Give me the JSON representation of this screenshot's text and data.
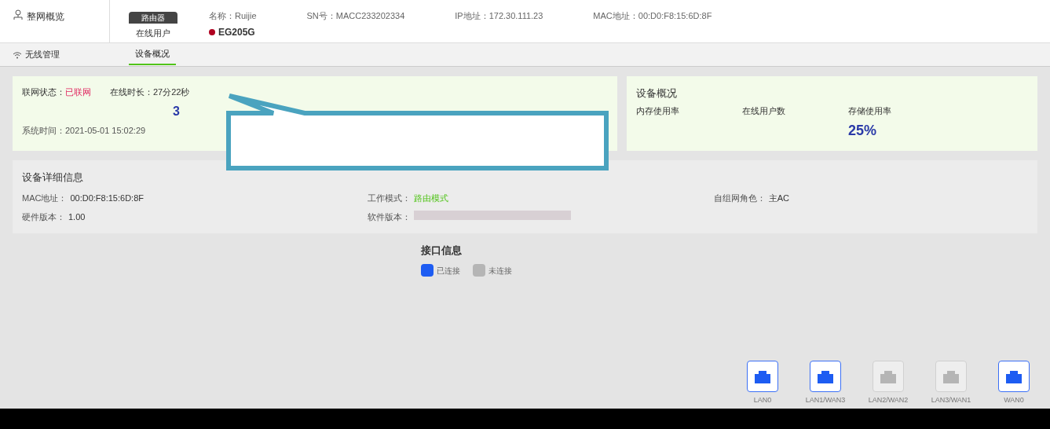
{
  "sidebar": {
    "title": "整网概览",
    "menu_item": "无线管理"
  },
  "device": {
    "badge": "路由器",
    "online_label": "在线用户",
    "model": "EG205G",
    "fields": [
      {
        "text": "名称：Ruijie"
      },
      {
        "text": "SN号：MACC233202334"
      },
      {
        "text": "IP地址：172.30.111.23"
      },
      {
        "text": "MAC地址：00:D0:F8:15:6D:8F"
      }
    ]
  },
  "tabs": [
    {
      "label": "设备概况",
      "selected": true
    }
  ],
  "status": {
    "network": {
      "label": "联网状态：",
      "value": "已联网"
    },
    "uptime": "在线时长：27分22秒",
    "count": "3",
    "system_time": "系统时间：2021-05-01 15:02:29"
  },
  "overview": {
    "title": "设备概况",
    "metrics": [
      {
        "label": "内存使用率"
      },
      {
        "label": "在线用户数"
      },
      {
        "label": "存储使用率",
        "value": "25%"
      }
    ]
  },
  "details": {
    "title": "设备详细信息",
    "fields": [
      {
        "label": "MAC地址：",
        "value": "00:D0:F8:15:6D:8F"
      },
      {
        "label": "工作模式：",
        "value": "路由模式"
      },
      {
        "label": "自组网角色：",
        "value": "主AC"
      },
      {
        "label": "硬件版本：",
        "value": "1.00"
      },
      {
        "label": "软件版本："
      }
    ]
  },
  "interfaces": {
    "title": "接口信息",
    "legend": [
      {
        "label": "已连接",
        "connected": true
      },
      {
        "label": "未连接",
        "connected": false
      }
    ],
    "ports": [
      {
        "name": "LAN0",
        "connected": true
      },
      {
        "name": "LAN1/WAN3",
        "connected": true
      },
      {
        "name": "LAN2/WAN2",
        "connected": false
      },
      {
        "name": "LAN3/WAN1",
        "connected": false
      },
      {
        "name": "WAN0",
        "connected": true
      }
    ]
  }
}
